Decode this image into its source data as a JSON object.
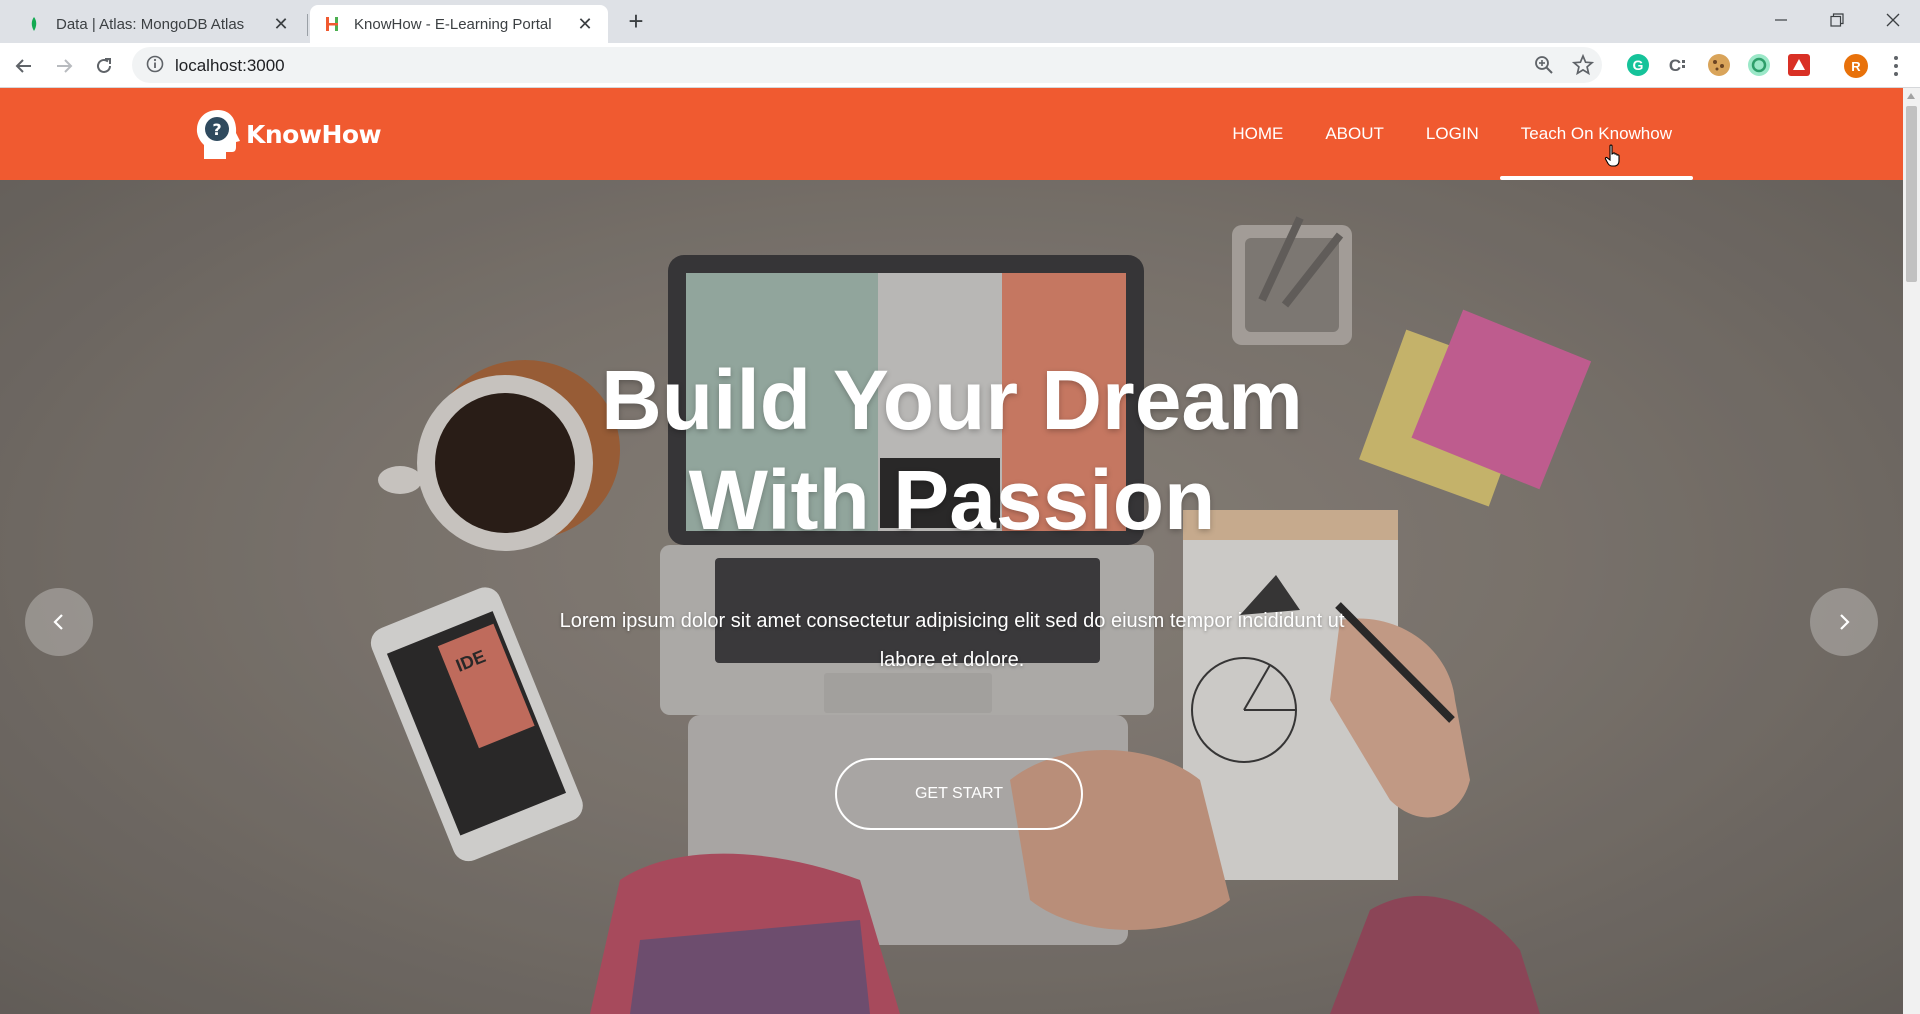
{
  "browser": {
    "tabs": [
      {
        "title": "Data | Atlas: MongoDB Atlas",
        "active": false,
        "icon": "mongodb-leaf-icon"
      },
      {
        "title": "KnowHow - E-Learning Portal",
        "active": true,
        "icon": "knowhow-h-icon"
      }
    ],
    "close_glyph": "✕",
    "new_tab_glyph": "+",
    "url": "localhost:3000",
    "avatar_letter": "R",
    "window_controls": {
      "minimize": "—",
      "restore": "❐",
      "close": "✕"
    }
  },
  "site": {
    "brand": "KnowHow",
    "nav": [
      {
        "label": "HOME"
      },
      {
        "label": "ABOUT"
      },
      {
        "label": "LOGIN"
      },
      {
        "label": "Teach On Knowhow",
        "active": true
      }
    ],
    "accent_color": "#f05a30"
  },
  "hero": {
    "title_line1": "Build Your Dream",
    "title_line2": "With Passion",
    "subtitle": "Lorem ipsum dolor sit amet consectetur adipisicing elit sed do eiusm tempor incididunt ut labore et dolore.",
    "cta": "GET START",
    "prev_icon": "chevron-left-icon",
    "next_icon": "chevron-right-icon"
  }
}
